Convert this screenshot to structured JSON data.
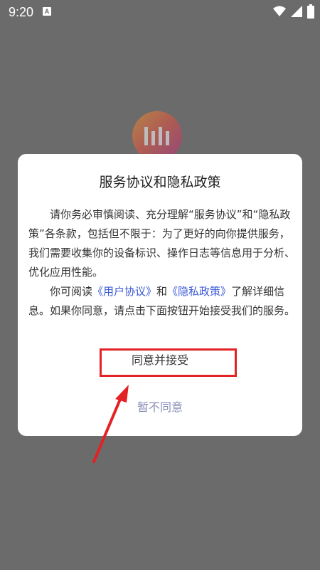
{
  "status_bar": {
    "time": "9:20",
    "notification_letter": "A",
    "icons": [
      "wifi-icon",
      "signal-icon",
      "battery-icon"
    ]
  },
  "app": {
    "logo_icon": "app-logo-icon"
  },
  "dialog": {
    "title": "服务协议和隐私政策",
    "para1": "请你务必审慎阅读、充分理解“服务协议”和“隐私政策”各条款，包括但不限于：为了更好的向你提供服务，我们需要收集你的设备标识、操作日志等信息用于分析、优化应用性能。",
    "para2_prefix": "你可阅读",
    "user_agreement_link": "《用户协议》",
    "para2_and": "和",
    "privacy_policy_link": "《隐私政策》",
    "para2_suffix": "了解详细信息。如果你同意，请点击下面按钮开始接受我们的服务。",
    "agree_button": "同意并接受",
    "decline_button": "暂不同意"
  },
  "colors": {
    "overlay": "#6b6b6b",
    "link": "#3a58d6",
    "decline": "#8a8fb7",
    "annotation_red": "#e32226"
  }
}
